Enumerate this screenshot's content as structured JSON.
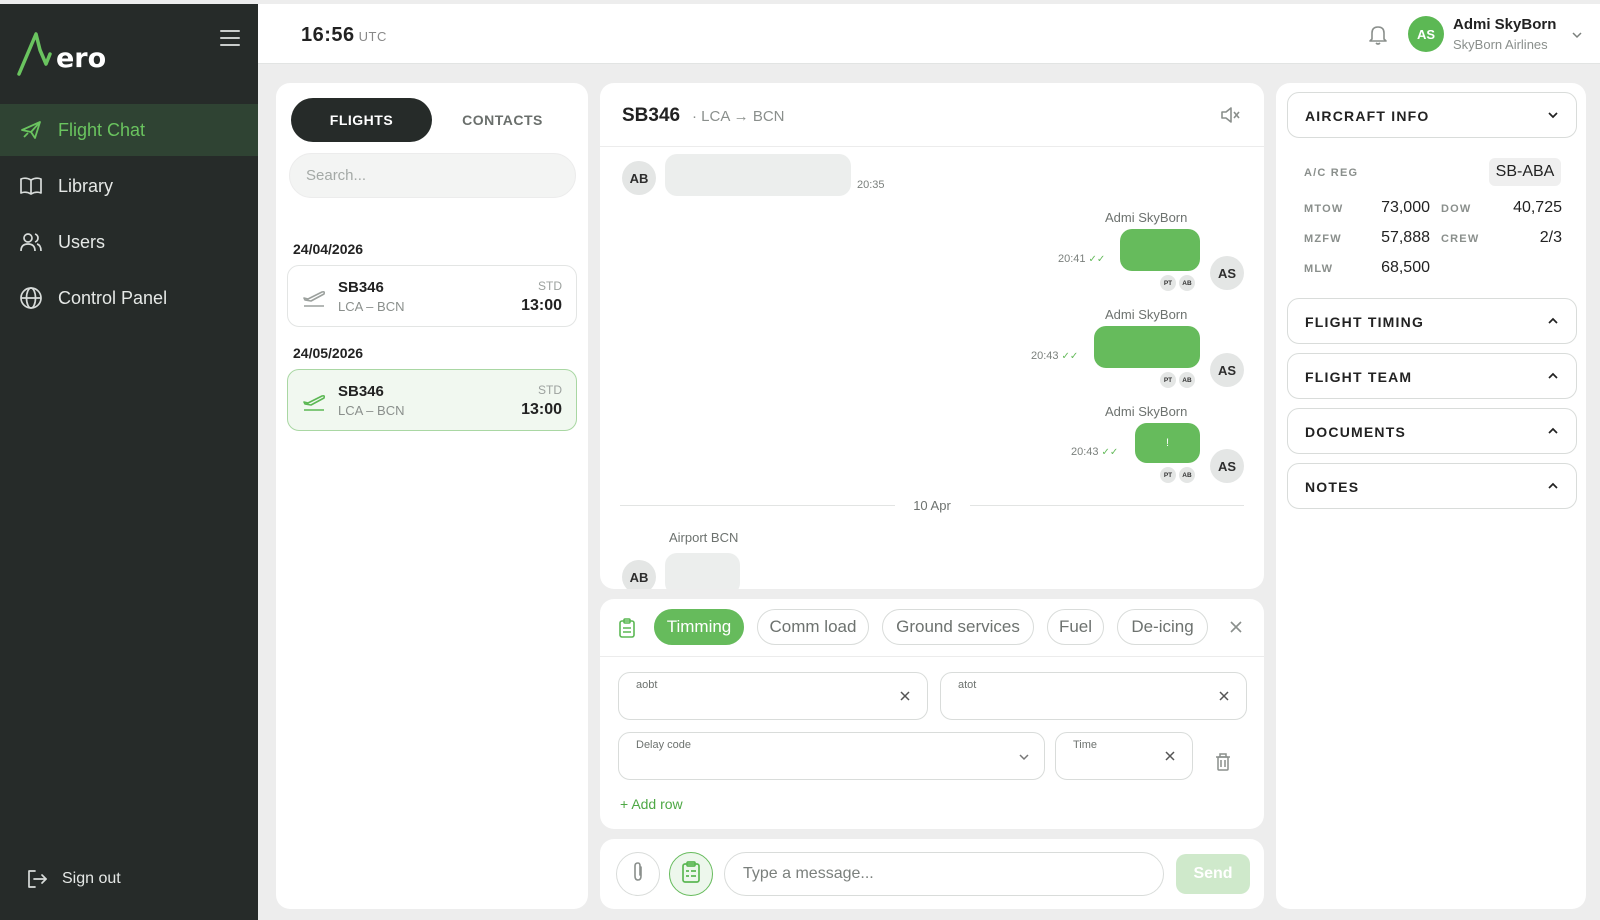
{
  "app": {
    "logo_text": "ero",
    "time": "16:56",
    "timezone": "UTC",
    "user_initials": "AS",
    "user_name": "Admi SkyBorn",
    "user_org": "SkyBorn Airlines"
  },
  "sidebar": {
    "items": [
      {
        "label": "Flight Chat",
        "icon": "plane-icon",
        "active": true
      },
      {
        "label": "Library",
        "icon": "book-icon",
        "active": false
      },
      {
        "label": "Users",
        "icon": "users-icon",
        "active": false
      },
      {
        "label": "Control Panel",
        "icon": "globe-icon",
        "active": false
      }
    ],
    "sign_out": "Sign out"
  },
  "flights_panel": {
    "tabs": [
      "FLIGHTS",
      "CONTACTS"
    ],
    "active_tab": "FLIGHTS",
    "search_placeholder": "Search...",
    "groups": [
      {
        "date": "24/04/2026",
        "flight": "SB346",
        "route": "LCA – BCN",
        "std_label": "STD",
        "std": "13:00",
        "selected": false
      },
      {
        "date": "24/05/2026",
        "flight": "SB346",
        "route": "LCA – BCN",
        "std_label": "STD",
        "std": "13:00",
        "selected": true
      }
    ]
  },
  "chat": {
    "flight": "SB346",
    "route": "· LCA → BCN",
    "messages": [
      {
        "sender": "",
        "initials": "AB",
        "time": "20:35",
        "outgoing": false
      },
      {
        "sender": "Admi SkyBorn",
        "initials": "AS",
        "time": "20:41",
        "outgoing": true,
        "read_by": [
          "PT",
          "AB"
        ]
      },
      {
        "sender": "Admi SkyBorn",
        "initials": "AS",
        "time": "20:43",
        "outgoing": true,
        "read_by": [
          "PT",
          "AB"
        ]
      },
      {
        "sender": "Admi SkyBorn",
        "initials": "AS",
        "time": "20:43",
        "outgoing": true,
        "read_by": [
          "PT",
          "AB"
        ],
        "text": "!"
      },
      {
        "sender": "Airport BCN",
        "initials": "AB",
        "time": "",
        "outgoing": false
      }
    ],
    "date_separator": "10 Apr",
    "ticks": "✓✓"
  },
  "form": {
    "tabs": [
      "Timming",
      "Comm load",
      "Ground services",
      "Fuel",
      "De-icing"
    ],
    "active_tab": "Timming",
    "fields": {
      "aobt": "aobt",
      "atot": "atot",
      "delay_code": "Delay code",
      "time": "Time"
    },
    "add_row": "Add row",
    "add_row_prefix": "+"
  },
  "composer": {
    "placeholder": "Type a message...",
    "send": "Send"
  },
  "right_panel": {
    "aircraft_info": {
      "title": "AIRCRAFT INFO",
      "reg_label": "A/C REG",
      "reg": "SB-ABA",
      "mtow_label": "MTOW",
      "mtow": "73,000",
      "dow_label": "DOW",
      "dow": "40,725",
      "mzfw_label": "MZFW",
      "mzfw": "57,888",
      "crew_label": "CREW",
      "crew": "2/3",
      "mlw_label": "MLW",
      "mlw": "68,500"
    },
    "sections": [
      "FLIGHT TIMING",
      "FLIGHT TEAM",
      "DOCUMENTS",
      "NOTES"
    ]
  },
  "colors": {
    "accent": "#66bb5c",
    "sidebar_bg": "#262b29",
    "active_nav_bg": "#2f4333"
  }
}
